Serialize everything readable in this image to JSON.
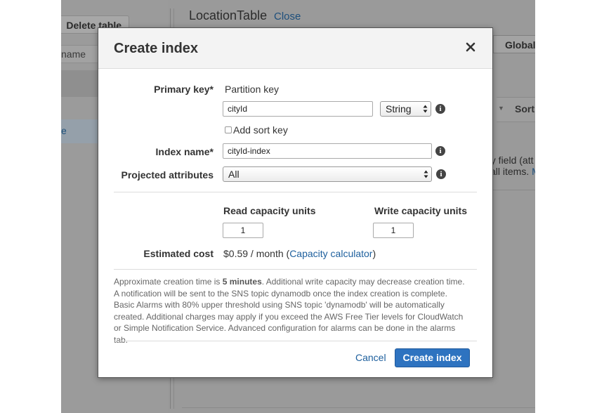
{
  "background": {
    "delete_table_label": "Delete table",
    "filter_placeholder_fragment": "name",
    "selected_row_fragment": "e",
    "table_title": "LocationTable",
    "close_link": "Close",
    "tab_global": "Global",
    "sort_column": "Sort",
    "empty_text_line1": "ny field (att",
    "empty_text_line2_pre": "all items.",
    "empty_text_line2_link": "M"
  },
  "modal": {
    "title": "Create index",
    "close_icon": "close-icon",
    "primary_key": {
      "label": "Primary key*",
      "partition_key_label": "Partition key",
      "partition_key_value": "cityId",
      "type_value": "String",
      "add_sort_key_label": "Add sort key",
      "add_sort_key_checked": false
    },
    "index_name": {
      "label": "Index name*",
      "value": "cityId-index"
    },
    "projected_attributes": {
      "label": "Projected attributes",
      "value": "All"
    },
    "capacity": {
      "read_label": "Read capacity units",
      "read_value": "1",
      "write_label": "Write capacity units",
      "write_value": "1"
    },
    "estimated_cost": {
      "label": "Estimated cost",
      "value": "$0.59 / month",
      "open_paren": "(",
      "calculator_link": "Capacity calculator",
      "close_paren": ")"
    },
    "note": {
      "line1_pre": "Approximate creation time is ",
      "line1_bold": "5 minutes",
      "line1_post": ". Additional write capacity may decrease creation time. A notification will be sent to the SNS topic dynamodb once the index creation is complete.",
      "line2": "Basic Alarms with 80% upper threshold using SNS topic 'dynamodb' will be automatically created. Additional charges may apply if you exceed the AWS Free Tier levels for CloudWatch or Simple Notification Service. Advanced configuration for alarms can be done in the alarms tab."
    },
    "buttons": {
      "cancel": "Cancel",
      "create": "Create index"
    },
    "colors": {
      "primary_button": "#2e73c0",
      "link": "#1d5f9d",
      "overlay": "#9a9a9a"
    }
  }
}
